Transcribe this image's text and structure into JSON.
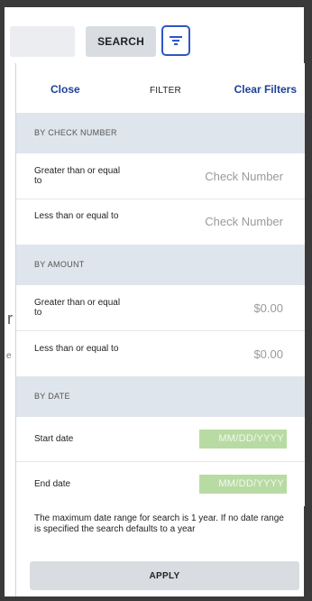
{
  "toolbar": {
    "search_label": "SEARCH"
  },
  "background": {
    "peek_char_1": "r",
    "peek_char_2": "e"
  },
  "filter_panel": {
    "close_label": "Close",
    "title": "FILTER",
    "clear_label": "Clear Filters",
    "sections": {
      "check_number": {
        "heading": "BY CHECK NUMBER",
        "min_label": "Greater than or equal to",
        "min_placeholder": "Check Number",
        "max_label": "Less than or equal to",
        "max_placeholder": "Check Number"
      },
      "amount": {
        "heading": "BY AMOUNT",
        "min_label": "Greater than or equal to",
        "min_placeholder": "$0.00",
        "max_label": "Less than or equal to",
        "max_placeholder": "$0.00"
      },
      "date": {
        "heading": "BY DATE",
        "start_label": "Start date",
        "start_placeholder": "MM/DD/YYYY",
        "end_label": "End date",
        "end_placeholder": "MM/DD/YYYY"
      }
    },
    "note": "The maximum date range for search is 1 year. If no date range is specified the search defaults to a year",
    "apply_label": "APPLY"
  },
  "colors": {
    "link": "#1e3f9a",
    "section_bg": "#dfe5ec",
    "date_field_bg": "#b8dba4",
    "filter_button_border": "#2f56c8",
    "button_bg": "#d9dde2"
  },
  "icons": {
    "filter_button": "filter-icon"
  }
}
